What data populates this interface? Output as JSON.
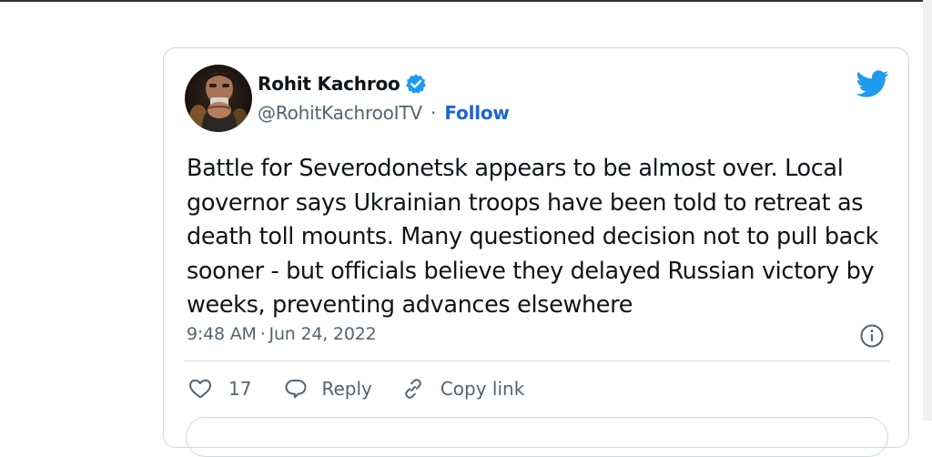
{
  "tweet": {
    "author": {
      "display_name": "Rohit Kachroo",
      "handle": "@RohitKachrooITV",
      "verified": true,
      "follow_label": "Follow",
      "separator": "·"
    },
    "text": "Battle for Severodonetsk appears to be almost over. Local governor says Ukrainian troops have been told to retreat as death toll mounts. Many questioned decision not to pull back sooner - but officials believe they delayed Russian victory by weeks, preventing advances elsewhere",
    "time": "9:48 AM",
    "date": "Jun 24, 2022",
    "meta_separator": "·",
    "actions": {
      "like_count": "17",
      "reply_label": "Reply",
      "copy_link_label": "Copy link"
    }
  },
  "icons": {
    "brand": "twitter-bird-icon",
    "verified": "verified-badge-icon",
    "info": "info-icon",
    "like": "heart-icon",
    "reply": "speech-bubble-icon",
    "copy_link": "link-icon"
  },
  "colors": {
    "accent_blue": "#1d9bf0",
    "follow_blue": "#1d64d8",
    "text_primary": "#0f1419",
    "text_secondary": "#536471",
    "border": "#cfd9de"
  }
}
